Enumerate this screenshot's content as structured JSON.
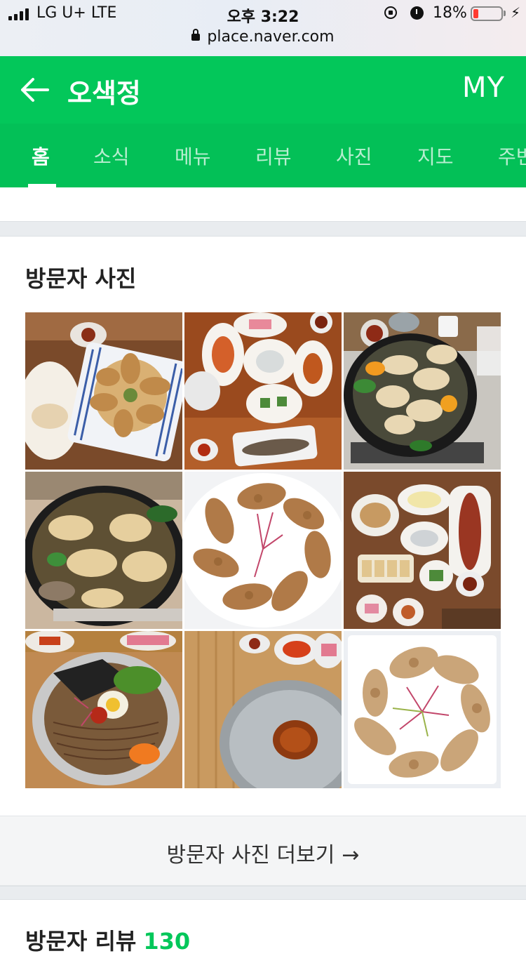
{
  "status_bar": {
    "carrier": "LG U+   LTE",
    "time": "오후 3:22",
    "url": "place.naver.com",
    "battery_percent_text": "18%",
    "battery_level": 0.18,
    "icons": [
      "signal-icon",
      "lock-icon",
      "rotation-lock-icon",
      "alarm-icon",
      "battery-icon",
      "charging-bolt-icon"
    ]
  },
  "header": {
    "title": "오색정",
    "right_label": "MY",
    "back_icon": "arrow-left-icon",
    "color": "#03c75a"
  },
  "tabs": {
    "items": [
      "홈",
      "소식",
      "메뉴",
      "리뷰",
      "사진",
      "지도",
      "주변"
    ],
    "active_index": 0,
    "color": "#03c057"
  },
  "visitor_photos": {
    "title": "방문자 사진",
    "photos": [
      "dumplings-on-striped-plate",
      "side-dishes-on-wooden-table",
      "dumpling-hot-pot",
      "dumpling-soup-pot",
      "pan-fried-dumplings-with-sprouts",
      "table-spread-with-fish",
      "cold-buckwheat-noodles",
      "empty-metal-bowl-with-sauce",
      "fried-dumplings-on-white-plate"
    ],
    "more_label": "방문자 사진 더보기",
    "more_arrow": "→"
  },
  "visitor_reviews": {
    "title": "방문자 리뷰",
    "count": "130",
    "count_color": "#03c75a"
  }
}
